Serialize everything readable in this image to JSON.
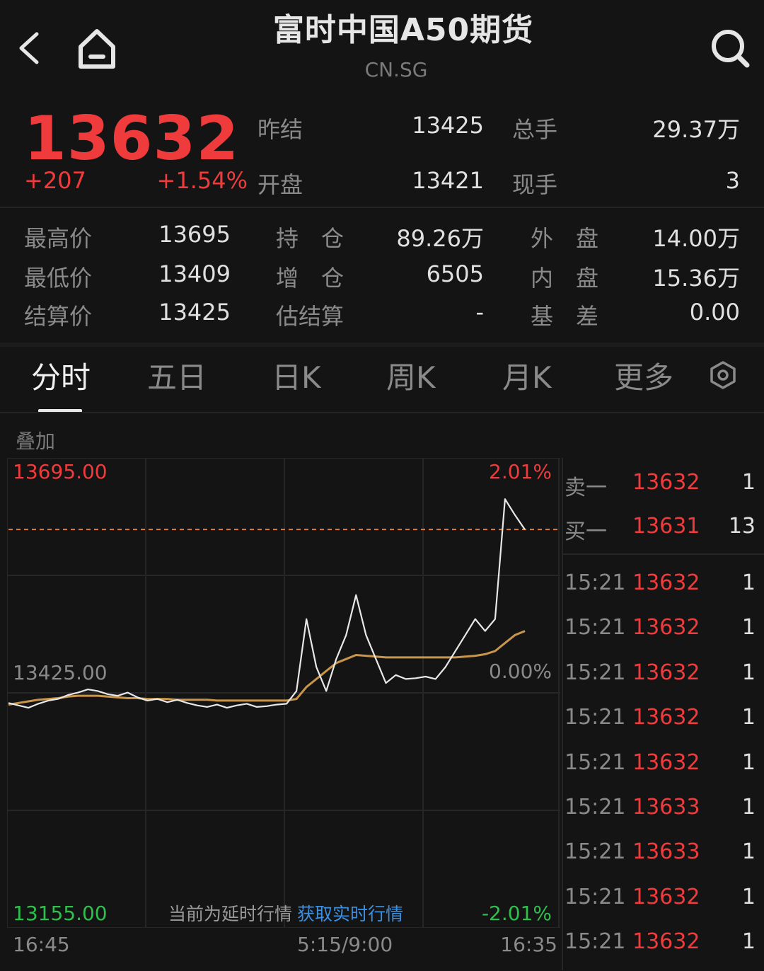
{
  "header": {
    "title": "富时中国A50期货",
    "subtitle": "CN.SG",
    "back_icon": "back-arrow-icon",
    "home_icon": "home-icon",
    "search_icon": "search-icon"
  },
  "quote": {
    "price": "13632",
    "change": "+207",
    "change_pct": "+1.54%",
    "stats": [
      {
        "label": "昨结",
        "value": "13425"
      },
      {
        "label": "总手",
        "value": "29.37万"
      },
      {
        "label": "开盘",
        "value": "13421"
      },
      {
        "label": "现手",
        "value": "3"
      },
      {
        "label": "最高价",
        "value": "13695"
      },
      {
        "label": "持　仓",
        "value": "89.26万"
      },
      {
        "label": "外　盘",
        "value": "14.00万"
      },
      {
        "label": "最低价",
        "value": "13409"
      },
      {
        "label": "增　仓",
        "value": "6505"
      },
      {
        "label": "内　盘",
        "value": "15.36万"
      },
      {
        "label": "结算价",
        "value": "13425"
      },
      {
        "label": "估结算",
        "value": "-"
      },
      {
        "label": "基　差",
        "value": "0.00"
      }
    ]
  },
  "tabs": [
    "分时",
    "五日",
    "日K",
    "周K",
    "月K",
    "更多"
  ],
  "active_tab": "分时",
  "settings_icon": "hexagon-settings-icon",
  "chart": {
    "overlay_label": "叠加",
    "y_high": "13695.00",
    "y_mid": "13425.00",
    "y_low": "13155.00",
    "pct_high": "2.01%",
    "pct_mid": "0.00%",
    "pct_low": "-2.01%",
    "x_start": "16:45",
    "x_mid": "5:15/9:00",
    "x_end": "16:35",
    "delay_notice": "当前为延时行情",
    "realtime_link": "获取实时行情",
    "colors": {
      "price_line": "#e8e8e8",
      "avg_line": "#c9954a",
      "up": "#ef3b3b",
      "down": "#2fbf4d"
    }
  },
  "chart_data": {
    "type": "line",
    "title": "",
    "xlabel": "",
    "ylabel": "",
    "ylim": [
      13155,
      13695
    ],
    "x_ticks": [
      "16:45",
      "5:15/9:00",
      "16:35"
    ],
    "reference_price": 13425,
    "series": [
      {
        "values": [
          13415,
          13412,
          13409,
          13414,
          13418,
          13420,
          13425,
          13428,
          13432,
          13430,
          13426,
          13424,
          13428,
          13422,
          13418,
          13420,
          13416,
          13419,
          13415,
          13412,
          13410,
          13413,
          13409,
          13412,
          13414,
          13410,
          13411,
          13413,
          13414,
          13430,
          13520,
          13460,
          13430,
          13470,
          13500,
          13550,
          13500,
          13470,
          13440,
          13450,
          13445,
          13446,
          13448,
          13445,
          13460,
          13480,
          13500,
          13520,
          13505,
          13520,
          13670,
          13650,
          13632
        ]
      },
      {
        "values": [
          13413,
          13415,
          13417,
          13419,
          13420,
          13421,
          13423,
          13424,
          13424,
          13424,
          13423,
          13422,
          13421,
          13421,
          13420,
          13420,
          13420,
          13419,
          13419,
          13419,
          13419,
          13418,
          13418,
          13418,
          13418,
          13418,
          13418,
          13418,
          13418,
          13420,
          13435,
          13445,
          13455,
          13465,
          13470,
          13475,
          13474,
          13473,
          13472,
          13472,
          13472,
          13472,
          13472,
          13472,
          13472,
          13472,
          13473,
          13474,
          13476,
          13480,
          13490,
          13500,
          13505
        ]
      }
    ]
  },
  "orderbook": {
    "sell1": {
      "label": "卖一",
      "price": "13632",
      "qty": "1"
    },
    "buy1": {
      "label": "买一",
      "price": "13631",
      "qty": "13"
    },
    "trades": [
      {
        "time": "15:21",
        "price": "13632",
        "qty": "1",
        "dir": "up"
      },
      {
        "time": "15:21",
        "price": "13632",
        "qty": "1",
        "dir": "up"
      },
      {
        "time": "15:21",
        "price": "13632",
        "qty": "1",
        "dir": "up"
      },
      {
        "time": "15:21",
        "price": "13632",
        "qty": "1",
        "dir": "down"
      },
      {
        "time": "15:21",
        "price": "13632",
        "qty": "1",
        "dir": "up"
      },
      {
        "time": "15:21",
        "price": "13633",
        "qty": "1",
        "dir": "up"
      },
      {
        "time": "15:21",
        "price": "13633",
        "qty": "1",
        "dir": "down"
      },
      {
        "time": "15:21",
        "price": "13632",
        "qty": "1",
        "dir": "down"
      },
      {
        "time": "15:21",
        "price": "13632",
        "qty": "1",
        "dir": "down"
      }
    ]
  }
}
